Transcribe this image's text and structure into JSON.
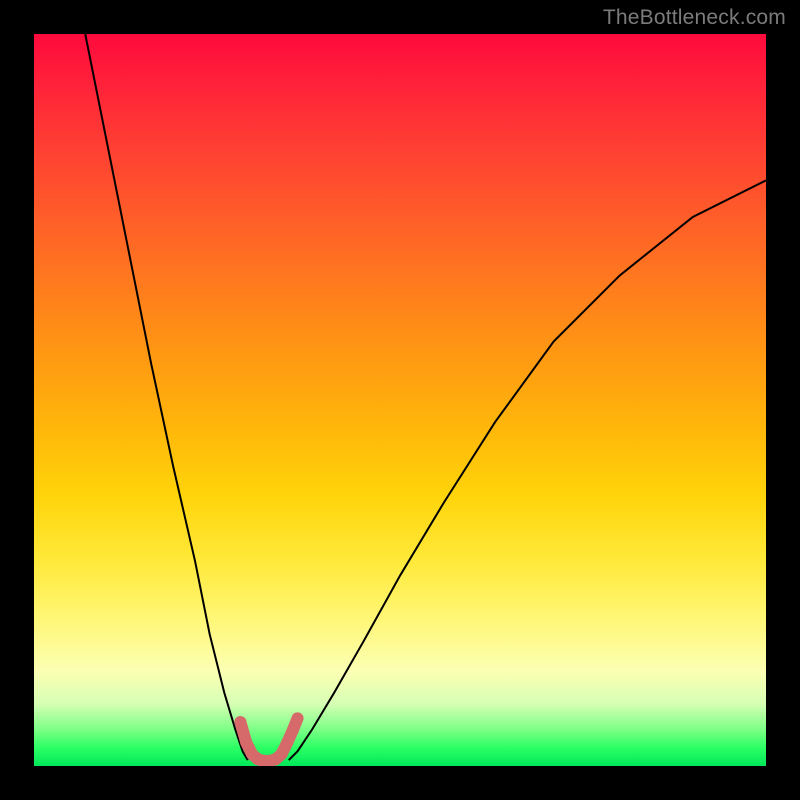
{
  "watermark": "TheBottleneck.com",
  "chart_data": {
    "type": "line",
    "title": "",
    "xlabel": "",
    "ylabel": "",
    "xlim": [
      0,
      100
    ],
    "ylim": [
      0,
      100
    ],
    "grid": false,
    "legend": false,
    "background": "rainbow-gradient-vertical",
    "series": [
      {
        "name": "left-branch",
        "stroke": "#000000",
        "stroke_width": 2,
        "x": [
          7,
          10,
          13,
          16,
          19,
          22,
          24,
          26,
          27.5,
          28.5,
          29.2
        ],
        "y": [
          100,
          85,
          70,
          55,
          41,
          28,
          18,
          10,
          5,
          2,
          0.8
        ]
      },
      {
        "name": "right-branch",
        "stroke": "#000000",
        "stroke_width": 2,
        "x": [
          34.8,
          36,
          38,
          41,
          45,
          50,
          56,
          63,
          71,
          80,
          90,
          100
        ],
        "y": [
          0.8,
          2,
          5,
          10,
          17,
          26,
          36,
          47,
          58,
          67,
          75,
          80
        ]
      },
      {
        "name": "valley-highlight",
        "stroke": "#d66a6a",
        "stroke_width": 12,
        "linecap": "round",
        "x": [
          28.2,
          29.0,
          29.8,
          30.6,
          31.4,
          32.2,
          33.0,
          33.8,
          34.6,
          35.4,
          36.0
        ],
        "y": [
          6.0,
          3.2,
          1.6,
          0.9,
          0.7,
          0.7,
          0.9,
          1.6,
          3.2,
          5.0,
          6.5
        ]
      }
    ]
  }
}
